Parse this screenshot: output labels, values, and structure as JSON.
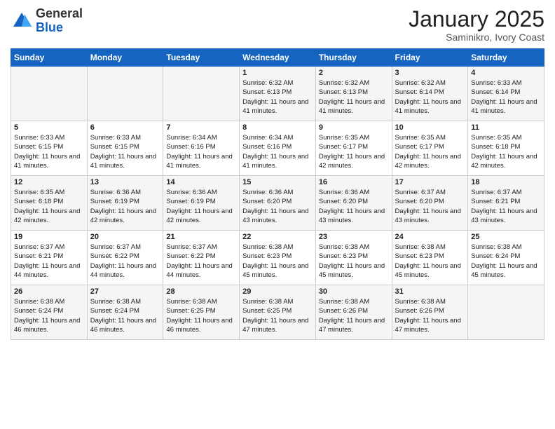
{
  "logo": {
    "general": "General",
    "blue": "Blue"
  },
  "title": "January 2025",
  "subtitle": "Saminikro, Ivory Coast",
  "headers": [
    "Sunday",
    "Monday",
    "Tuesday",
    "Wednesday",
    "Thursday",
    "Friday",
    "Saturday"
  ],
  "weeks": [
    [
      {
        "day": "",
        "info": ""
      },
      {
        "day": "",
        "info": ""
      },
      {
        "day": "",
        "info": ""
      },
      {
        "day": "1",
        "info": "Sunrise: 6:32 AM\nSunset: 6:13 PM\nDaylight: 11 hours and 41 minutes."
      },
      {
        "day": "2",
        "info": "Sunrise: 6:32 AM\nSunset: 6:13 PM\nDaylight: 11 hours and 41 minutes."
      },
      {
        "day": "3",
        "info": "Sunrise: 6:32 AM\nSunset: 6:14 PM\nDaylight: 11 hours and 41 minutes."
      },
      {
        "day": "4",
        "info": "Sunrise: 6:33 AM\nSunset: 6:14 PM\nDaylight: 11 hours and 41 minutes."
      }
    ],
    [
      {
        "day": "5",
        "info": "Sunrise: 6:33 AM\nSunset: 6:15 PM\nDaylight: 11 hours and 41 minutes."
      },
      {
        "day": "6",
        "info": "Sunrise: 6:33 AM\nSunset: 6:15 PM\nDaylight: 11 hours and 41 minutes."
      },
      {
        "day": "7",
        "info": "Sunrise: 6:34 AM\nSunset: 6:16 PM\nDaylight: 11 hours and 41 minutes."
      },
      {
        "day": "8",
        "info": "Sunrise: 6:34 AM\nSunset: 6:16 PM\nDaylight: 11 hours and 41 minutes."
      },
      {
        "day": "9",
        "info": "Sunrise: 6:35 AM\nSunset: 6:17 PM\nDaylight: 11 hours and 42 minutes."
      },
      {
        "day": "10",
        "info": "Sunrise: 6:35 AM\nSunset: 6:17 PM\nDaylight: 11 hours and 42 minutes."
      },
      {
        "day": "11",
        "info": "Sunrise: 6:35 AM\nSunset: 6:18 PM\nDaylight: 11 hours and 42 minutes."
      }
    ],
    [
      {
        "day": "12",
        "info": "Sunrise: 6:35 AM\nSunset: 6:18 PM\nDaylight: 11 hours and 42 minutes."
      },
      {
        "day": "13",
        "info": "Sunrise: 6:36 AM\nSunset: 6:19 PM\nDaylight: 11 hours and 42 minutes."
      },
      {
        "day": "14",
        "info": "Sunrise: 6:36 AM\nSunset: 6:19 PM\nDaylight: 11 hours and 42 minutes."
      },
      {
        "day": "15",
        "info": "Sunrise: 6:36 AM\nSunset: 6:20 PM\nDaylight: 11 hours and 43 minutes."
      },
      {
        "day": "16",
        "info": "Sunrise: 6:36 AM\nSunset: 6:20 PM\nDaylight: 11 hours and 43 minutes."
      },
      {
        "day": "17",
        "info": "Sunrise: 6:37 AM\nSunset: 6:20 PM\nDaylight: 11 hours and 43 minutes."
      },
      {
        "day": "18",
        "info": "Sunrise: 6:37 AM\nSunset: 6:21 PM\nDaylight: 11 hours and 43 minutes."
      }
    ],
    [
      {
        "day": "19",
        "info": "Sunrise: 6:37 AM\nSunset: 6:21 PM\nDaylight: 11 hours and 44 minutes."
      },
      {
        "day": "20",
        "info": "Sunrise: 6:37 AM\nSunset: 6:22 PM\nDaylight: 11 hours and 44 minutes."
      },
      {
        "day": "21",
        "info": "Sunrise: 6:37 AM\nSunset: 6:22 PM\nDaylight: 11 hours and 44 minutes."
      },
      {
        "day": "22",
        "info": "Sunrise: 6:38 AM\nSunset: 6:23 PM\nDaylight: 11 hours and 45 minutes."
      },
      {
        "day": "23",
        "info": "Sunrise: 6:38 AM\nSunset: 6:23 PM\nDaylight: 11 hours and 45 minutes."
      },
      {
        "day": "24",
        "info": "Sunrise: 6:38 AM\nSunset: 6:23 PM\nDaylight: 11 hours and 45 minutes."
      },
      {
        "day": "25",
        "info": "Sunrise: 6:38 AM\nSunset: 6:24 PM\nDaylight: 11 hours and 45 minutes."
      }
    ],
    [
      {
        "day": "26",
        "info": "Sunrise: 6:38 AM\nSunset: 6:24 PM\nDaylight: 11 hours and 46 minutes."
      },
      {
        "day": "27",
        "info": "Sunrise: 6:38 AM\nSunset: 6:24 PM\nDaylight: 11 hours and 46 minutes."
      },
      {
        "day": "28",
        "info": "Sunrise: 6:38 AM\nSunset: 6:25 PM\nDaylight: 11 hours and 46 minutes."
      },
      {
        "day": "29",
        "info": "Sunrise: 6:38 AM\nSunset: 6:25 PM\nDaylight: 11 hours and 47 minutes."
      },
      {
        "day": "30",
        "info": "Sunrise: 6:38 AM\nSunset: 6:26 PM\nDaylight: 11 hours and 47 minutes."
      },
      {
        "day": "31",
        "info": "Sunrise: 6:38 AM\nSunset: 6:26 PM\nDaylight: 11 hours and 47 minutes."
      },
      {
        "day": "",
        "info": ""
      }
    ]
  ]
}
